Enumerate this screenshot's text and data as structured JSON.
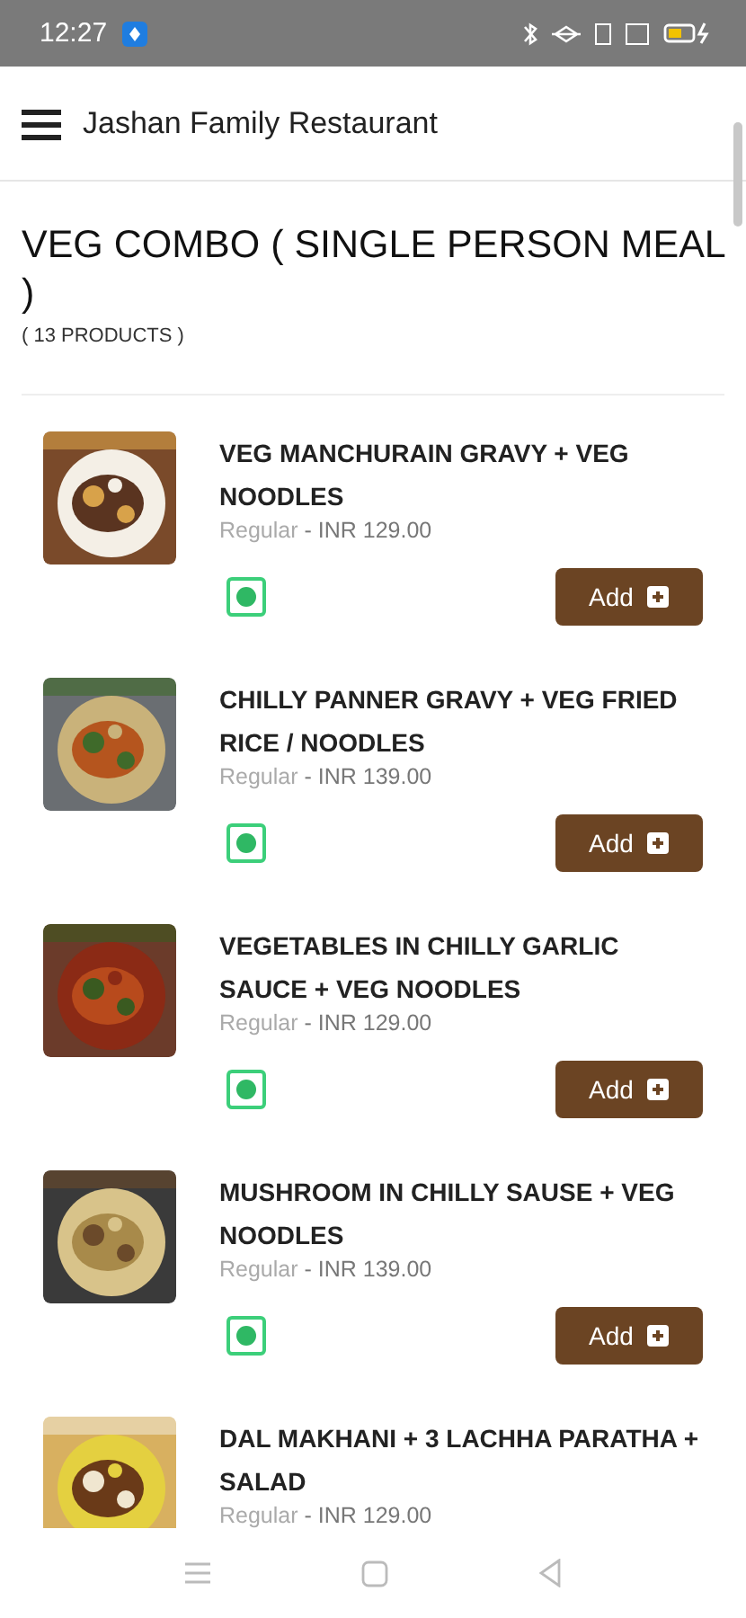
{
  "status_bar": {
    "time": "12:27"
  },
  "app_bar": {
    "title": "Jashan Family Restaurant"
  },
  "category": {
    "title": "VEG COMBO ( SINGLE PERSON MEAL )",
    "count": "( 13 PRODUCTS )"
  },
  "products": [
    {
      "name": "VEG MANCHURAIN GRAVY + VEG NOODLES",
      "variant": "Regular",
      "price": "- INR 129.00",
      "button": "Add"
    },
    {
      "name": "CHILLY PANNER GRAVY + VEG FRIED RICE / NOODLES",
      "variant": "Regular",
      "price": "- INR 139.00",
      "button": "Add"
    },
    {
      "name": "VEGETABLES IN CHILLY GARLIC SAUCE + VEG NOODLES",
      "variant": "Regular",
      "price": "- INR 129.00",
      "button": "Add"
    },
    {
      "name": "MUSHROOM IN CHILLY SAUSE + VEG NOODLES",
      "variant": "Regular",
      "price": "- INR 139.00",
      "button": "Add"
    },
    {
      "name": "DAL MAKHANI + 3 LACHHA PARATHA + SALAD",
      "variant": "Regular",
      "price": "- INR 129.00"
    }
  ]
}
